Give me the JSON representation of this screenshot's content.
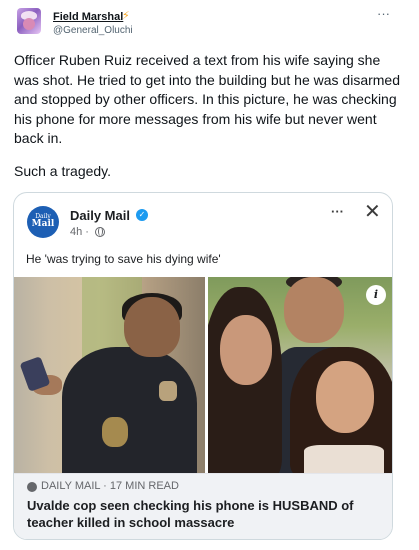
{
  "tweet": {
    "display_name": "Field Marshal",
    "name_emoji": "⚡",
    "handle": "@General_Oluchi",
    "more_icon": "more-horizontal-icon",
    "text": "Officer Ruben Ruiz received a text from his wife saying she was shot. He tried to get into the building but he was disarmed and stopped by other officers. In this picture, he was checking his phone for more messages from his wife but never went back in.",
    "text2": "Such a tragedy."
  },
  "card": {
    "page_logo_line1": "Daily",
    "page_logo_line2": "Mail",
    "page_name": "Daily Mail",
    "verified_glyph": "✓",
    "time": "4h ·",
    "post_text": "He 'was trying to save his dying wife'",
    "info_glyph": "i",
    "link": {
      "source": "DAILY MAIL · 17 MIN READ",
      "headline": "Uvalde cop seen checking his phone is HUSBAND of teacher killed in school massacre"
    }
  },
  "colors": {
    "accent": "#1d9bf0",
    "daily_mail_blue": "#1d5fb4",
    "card_border": "#cfd9de",
    "muted": "#536471"
  }
}
